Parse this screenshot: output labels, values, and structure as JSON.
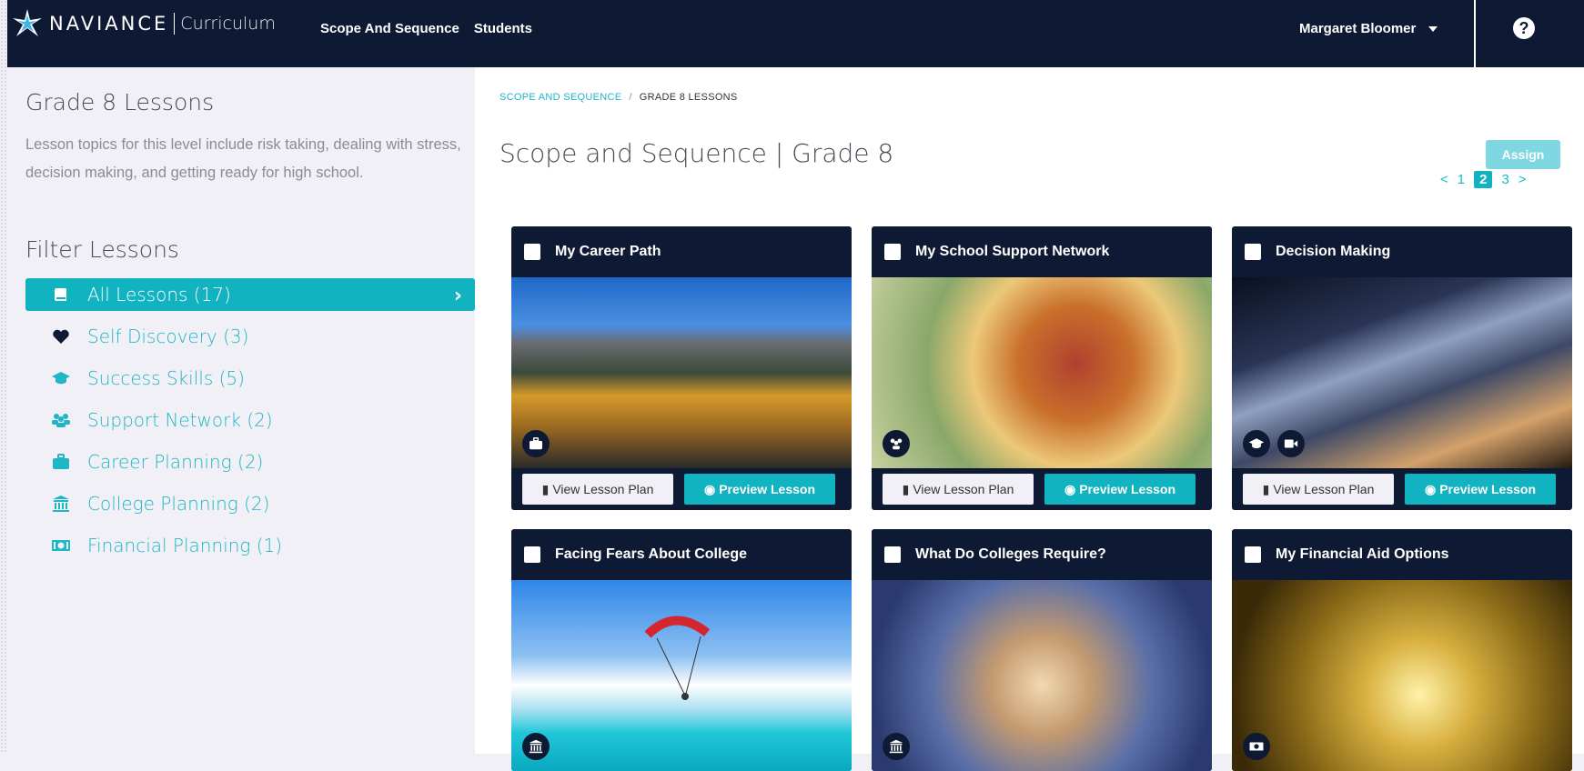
{
  "app": {
    "brand_name": "NAVIANCE",
    "product_name": "Curriculum"
  },
  "topnav": {
    "items": [
      "Scope And Sequence",
      "Students"
    ]
  },
  "user": {
    "name": "Margaret Bloomer"
  },
  "help": {
    "label": "?"
  },
  "sidebar": {
    "title": "Grade 8 Lessons",
    "description": "Lesson topics for this level include risk taking, dealing with stress, decision making, and getting ready for high school.",
    "filter_title": "Filter Lessons",
    "filters": [
      {
        "label": "All Lessons (17)",
        "icon": "book-icon",
        "active": true
      },
      {
        "label": "Self Discovery (3)",
        "icon": "heart-icon",
        "active": false
      },
      {
        "label": "Success Skills (5)",
        "icon": "graduation-cap-icon",
        "active": false
      },
      {
        "label": "Support Network (2)",
        "icon": "users-icon",
        "active": false
      },
      {
        "label": "Career Planning (2)",
        "icon": "briefcase-icon",
        "active": false
      },
      {
        "label": "College Planning (2)",
        "icon": "institution-icon",
        "active": false
      },
      {
        "label": "Financial Planning (1)",
        "icon": "money-icon",
        "active": false
      }
    ]
  },
  "main": {
    "breadcrumb": {
      "link": "SCOPE AND SEQUENCE",
      "separator": "/",
      "current": "GRADE 8 LESSONS"
    },
    "title": "Scope and Sequence | Grade 8",
    "assign_label": "Assign",
    "pagination": {
      "prev": "<",
      "pages": [
        "1",
        "2",
        "3"
      ],
      "current": "2",
      "next": ">"
    },
    "view_plan_label": "View Lesson Plan",
    "preview_label": "Preview Lesson",
    "lessons": [
      {
        "title": "My Career Path",
        "badges": [
          "briefcase-icon"
        ]
      },
      {
        "title": "My School Support Network",
        "badges": [
          "users-icon"
        ]
      },
      {
        "title": "Decision Making",
        "badges": [
          "graduation-cap-icon",
          "video-camera-icon"
        ]
      },
      {
        "title": "Facing Fears About College",
        "badges": [
          "institution-icon"
        ]
      },
      {
        "title": "What Do Colleges Require?",
        "badges": [
          "institution-icon"
        ]
      },
      {
        "title": "My Financial Aid Options",
        "badges": [
          "money-icon"
        ]
      }
    ]
  },
  "colors": {
    "navbar": "#0e1a33",
    "accent": "#11b3c1",
    "sidebar_bg": "#f1f0f6"
  }
}
